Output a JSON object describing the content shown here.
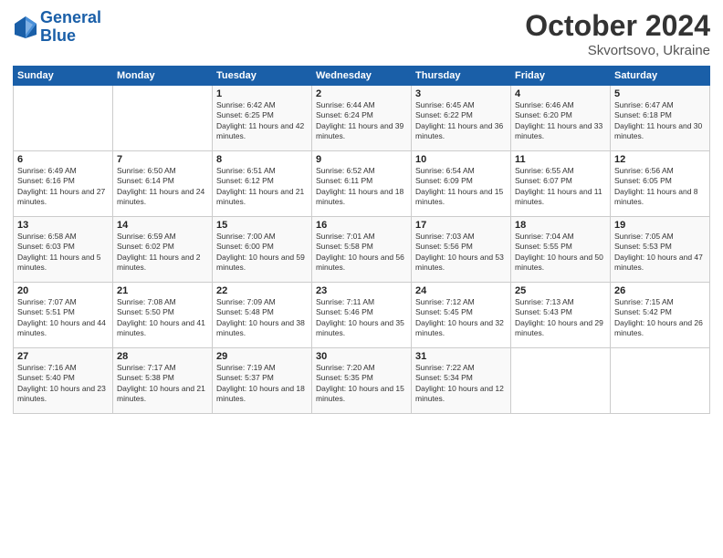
{
  "header": {
    "logo_line1": "General",
    "logo_line2": "Blue",
    "month": "October 2024",
    "location": "Skvortsovo, Ukraine"
  },
  "weekdays": [
    "Sunday",
    "Monday",
    "Tuesday",
    "Wednesday",
    "Thursday",
    "Friday",
    "Saturday"
  ],
  "rows": [
    [
      {
        "day": "",
        "sunrise": "",
        "sunset": "",
        "daylight": ""
      },
      {
        "day": "",
        "sunrise": "",
        "sunset": "",
        "daylight": ""
      },
      {
        "day": "1",
        "sunrise": "Sunrise: 6:42 AM",
        "sunset": "Sunset: 6:25 PM",
        "daylight": "Daylight: 11 hours and 42 minutes."
      },
      {
        "day": "2",
        "sunrise": "Sunrise: 6:44 AM",
        "sunset": "Sunset: 6:24 PM",
        "daylight": "Daylight: 11 hours and 39 minutes."
      },
      {
        "day": "3",
        "sunrise": "Sunrise: 6:45 AM",
        "sunset": "Sunset: 6:22 PM",
        "daylight": "Daylight: 11 hours and 36 minutes."
      },
      {
        "day": "4",
        "sunrise": "Sunrise: 6:46 AM",
        "sunset": "Sunset: 6:20 PM",
        "daylight": "Daylight: 11 hours and 33 minutes."
      },
      {
        "day": "5",
        "sunrise": "Sunrise: 6:47 AM",
        "sunset": "Sunset: 6:18 PM",
        "daylight": "Daylight: 11 hours and 30 minutes."
      }
    ],
    [
      {
        "day": "6",
        "sunrise": "Sunrise: 6:49 AM",
        "sunset": "Sunset: 6:16 PM",
        "daylight": "Daylight: 11 hours and 27 minutes."
      },
      {
        "day": "7",
        "sunrise": "Sunrise: 6:50 AM",
        "sunset": "Sunset: 6:14 PM",
        "daylight": "Daylight: 11 hours and 24 minutes."
      },
      {
        "day": "8",
        "sunrise": "Sunrise: 6:51 AM",
        "sunset": "Sunset: 6:12 PM",
        "daylight": "Daylight: 11 hours and 21 minutes."
      },
      {
        "day": "9",
        "sunrise": "Sunrise: 6:52 AM",
        "sunset": "Sunset: 6:11 PM",
        "daylight": "Daylight: 11 hours and 18 minutes."
      },
      {
        "day": "10",
        "sunrise": "Sunrise: 6:54 AM",
        "sunset": "Sunset: 6:09 PM",
        "daylight": "Daylight: 11 hours and 15 minutes."
      },
      {
        "day": "11",
        "sunrise": "Sunrise: 6:55 AM",
        "sunset": "Sunset: 6:07 PM",
        "daylight": "Daylight: 11 hours and 11 minutes."
      },
      {
        "day": "12",
        "sunrise": "Sunrise: 6:56 AM",
        "sunset": "Sunset: 6:05 PM",
        "daylight": "Daylight: 11 hours and 8 minutes."
      }
    ],
    [
      {
        "day": "13",
        "sunrise": "Sunrise: 6:58 AM",
        "sunset": "Sunset: 6:03 PM",
        "daylight": "Daylight: 11 hours and 5 minutes."
      },
      {
        "day": "14",
        "sunrise": "Sunrise: 6:59 AM",
        "sunset": "Sunset: 6:02 PM",
        "daylight": "Daylight: 11 hours and 2 minutes."
      },
      {
        "day": "15",
        "sunrise": "Sunrise: 7:00 AM",
        "sunset": "Sunset: 6:00 PM",
        "daylight": "Daylight: 10 hours and 59 minutes."
      },
      {
        "day": "16",
        "sunrise": "Sunrise: 7:01 AM",
        "sunset": "Sunset: 5:58 PM",
        "daylight": "Daylight: 10 hours and 56 minutes."
      },
      {
        "day": "17",
        "sunrise": "Sunrise: 7:03 AM",
        "sunset": "Sunset: 5:56 PM",
        "daylight": "Daylight: 10 hours and 53 minutes."
      },
      {
        "day": "18",
        "sunrise": "Sunrise: 7:04 AM",
        "sunset": "Sunset: 5:55 PM",
        "daylight": "Daylight: 10 hours and 50 minutes."
      },
      {
        "day": "19",
        "sunrise": "Sunrise: 7:05 AM",
        "sunset": "Sunset: 5:53 PM",
        "daylight": "Daylight: 10 hours and 47 minutes."
      }
    ],
    [
      {
        "day": "20",
        "sunrise": "Sunrise: 7:07 AM",
        "sunset": "Sunset: 5:51 PM",
        "daylight": "Daylight: 10 hours and 44 minutes."
      },
      {
        "day": "21",
        "sunrise": "Sunrise: 7:08 AM",
        "sunset": "Sunset: 5:50 PM",
        "daylight": "Daylight: 10 hours and 41 minutes."
      },
      {
        "day": "22",
        "sunrise": "Sunrise: 7:09 AM",
        "sunset": "Sunset: 5:48 PM",
        "daylight": "Daylight: 10 hours and 38 minutes."
      },
      {
        "day": "23",
        "sunrise": "Sunrise: 7:11 AM",
        "sunset": "Sunset: 5:46 PM",
        "daylight": "Daylight: 10 hours and 35 minutes."
      },
      {
        "day": "24",
        "sunrise": "Sunrise: 7:12 AM",
        "sunset": "Sunset: 5:45 PM",
        "daylight": "Daylight: 10 hours and 32 minutes."
      },
      {
        "day": "25",
        "sunrise": "Sunrise: 7:13 AM",
        "sunset": "Sunset: 5:43 PM",
        "daylight": "Daylight: 10 hours and 29 minutes."
      },
      {
        "day": "26",
        "sunrise": "Sunrise: 7:15 AM",
        "sunset": "Sunset: 5:42 PM",
        "daylight": "Daylight: 10 hours and 26 minutes."
      }
    ],
    [
      {
        "day": "27",
        "sunrise": "Sunrise: 7:16 AM",
        "sunset": "Sunset: 5:40 PM",
        "daylight": "Daylight: 10 hours and 23 minutes."
      },
      {
        "day": "28",
        "sunrise": "Sunrise: 7:17 AM",
        "sunset": "Sunset: 5:38 PM",
        "daylight": "Daylight: 10 hours and 21 minutes."
      },
      {
        "day": "29",
        "sunrise": "Sunrise: 7:19 AM",
        "sunset": "Sunset: 5:37 PM",
        "daylight": "Daylight: 10 hours and 18 minutes."
      },
      {
        "day": "30",
        "sunrise": "Sunrise: 7:20 AM",
        "sunset": "Sunset: 5:35 PM",
        "daylight": "Daylight: 10 hours and 15 minutes."
      },
      {
        "day": "31",
        "sunrise": "Sunrise: 7:22 AM",
        "sunset": "Sunset: 5:34 PM",
        "daylight": "Daylight: 10 hours and 12 minutes."
      },
      {
        "day": "",
        "sunrise": "",
        "sunset": "",
        "daylight": ""
      },
      {
        "day": "",
        "sunrise": "",
        "sunset": "",
        "daylight": ""
      }
    ]
  ]
}
